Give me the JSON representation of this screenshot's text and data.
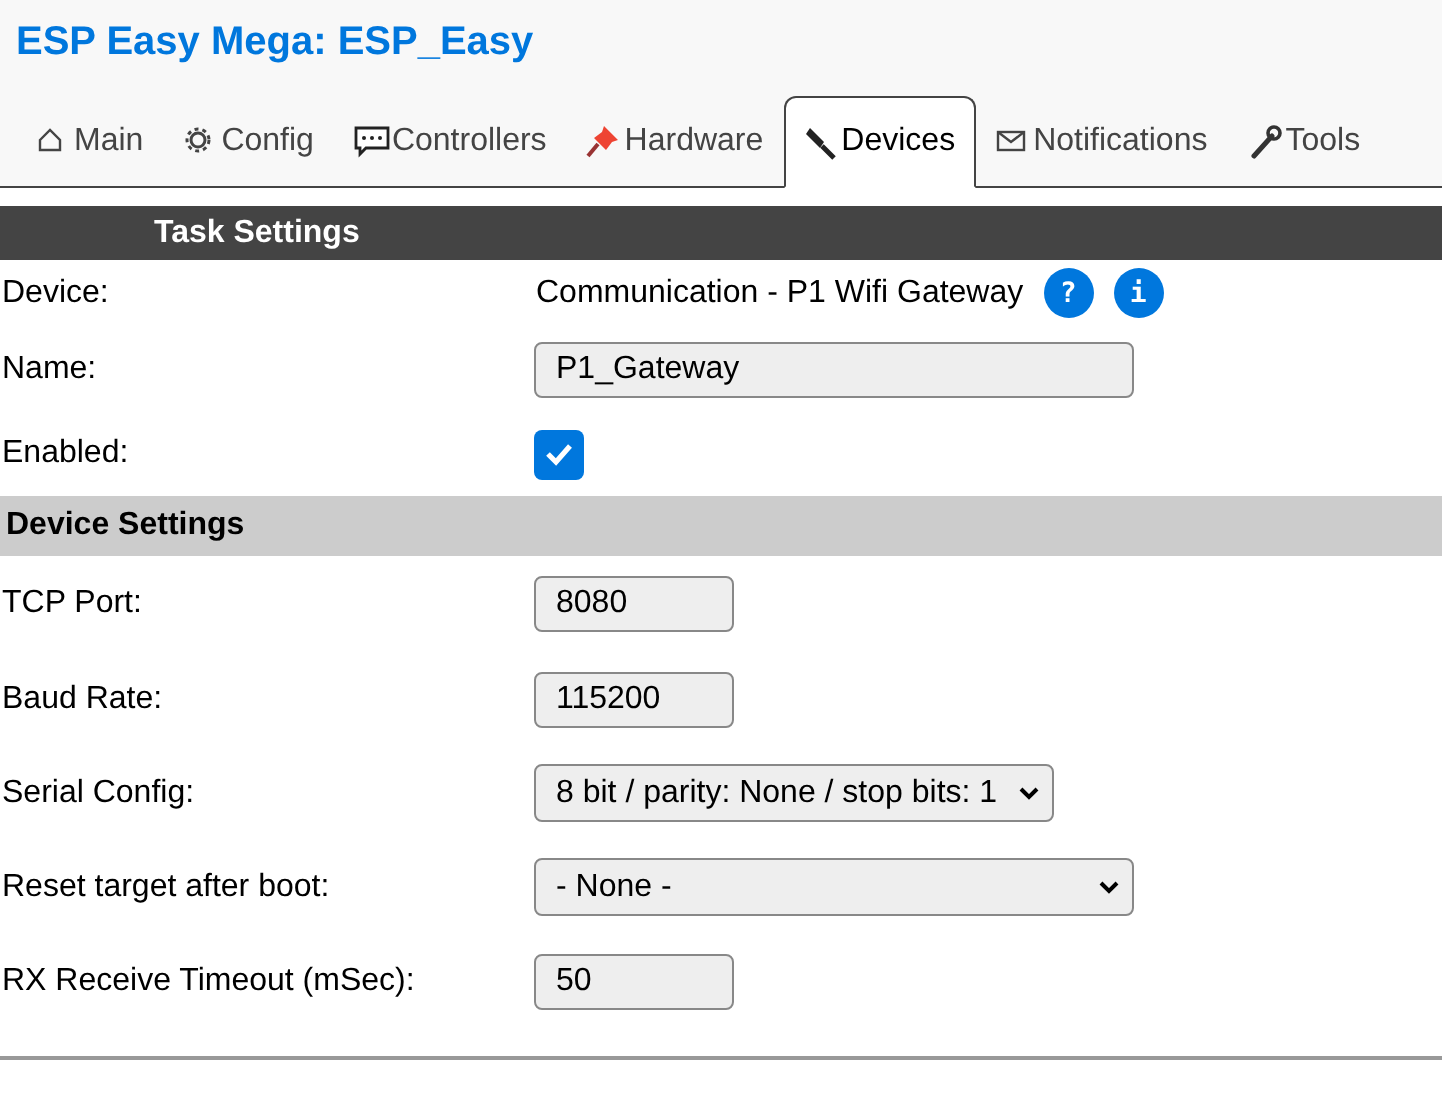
{
  "title": "ESP Easy Mega: ESP_Easy",
  "tabs": [
    {
      "label": "Main",
      "selected": false
    },
    {
      "label": "Config",
      "selected": false
    },
    {
      "label": "Controllers",
      "selected": false
    },
    {
      "label": "Hardware",
      "selected": false
    },
    {
      "label": "Devices",
      "selected": true
    },
    {
      "label": "Notifications",
      "selected": false
    },
    {
      "label": "Tools",
      "selected": false
    }
  ],
  "task_settings": {
    "heading": "Task Settings",
    "rows": [
      {
        "kind": "device",
        "label": "Device:",
        "value": "Communication - P1 Wifi Gateway",
        "help": "?",
        "info": "i"
      },
      {
        "kind": "text",
        "label": "Name:",
        "value": "P1_Gateway"
      },
      {
        "kind": "checkbox",
        "label": "Enabled:",
        "checked": true
      }
    ]
  },
  "device_settings": {
    "heading": "Device Settings",
    "rows": [
      {
        "kind": "text",
        "label": "TCP Port:",
        "value": "8080"
      },
      {
        "kind": "text",
        "label": "Baud Rate:",
        "value": "115200"
      },
      {
        "kind": "select",
        "label": "Serial Config:",
        "value": "8 bit / parity: None / stop bits: 1"
      },
      {
        "kind": "select",
        "label": "Reset target after boot:",
        "value": "- None -"
      },
      {
        "kind": "text",
        "label": "RX Receive Timeout (mSec):",
        "value": "50"
      }
    ]
  }
}
